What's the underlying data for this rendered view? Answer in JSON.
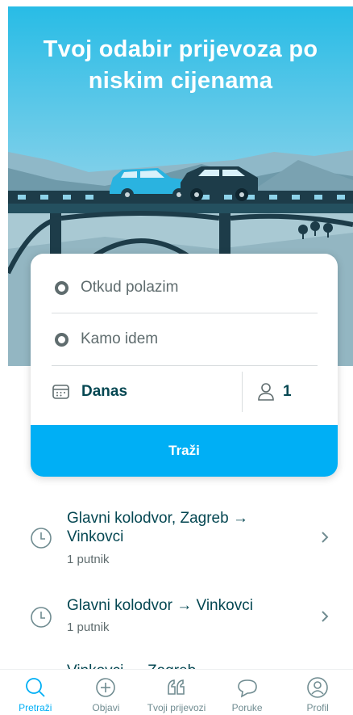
{
  "hero": {
    "title_line1": "Tvoj odabir prijevoza po",
    "title_line2": "niskim cijenama"
  },
  "search": {
    "from_placeholder": "Otkud polazim",
    "to_placeholder": "Kamo idem",
    "date_value": "Danas",
    "passengers_value": "1",
    "button_label": "Traži"
  },
  "recent_searches": [
    {
      "route_line1": "Glavni kolodvor, Zagreb →",
      "route_line2": "Vinkovci",
      "passengers": "1 putnik"
    },
    {
      "route_line1": "Glavni kolodvor → Vinkovci",
      "passengers": "1 putnik"
    }
  ],
  "recent_partial": "Vinkovci → Zagreb",
  "tabs": [
    {
      "label": "Pretraži",
      "icon": "search-icon",
      "active": true
    },
    {
      "label": "Objavi",
      "icon": "plus-circle-icon",
      "active": false
    },
    {
      "label": "Tvoji prijevozi",
      "icon": "quote-icon",
      "active": false
    },
    {
      "label": "Poruke",
      "icon": "chat-bubble-icon",
      "active": false
    },
    {
      "label": "Profil",
      "icon": "profile-icon",
      "active": false
    }
  ],
  "colors": {
    "accent": "#00aff5",
    "text_dark": "#054752",
    "text_muted": "#5f6c6e",
    "tab_inactive": "#708c91"
  }
}
